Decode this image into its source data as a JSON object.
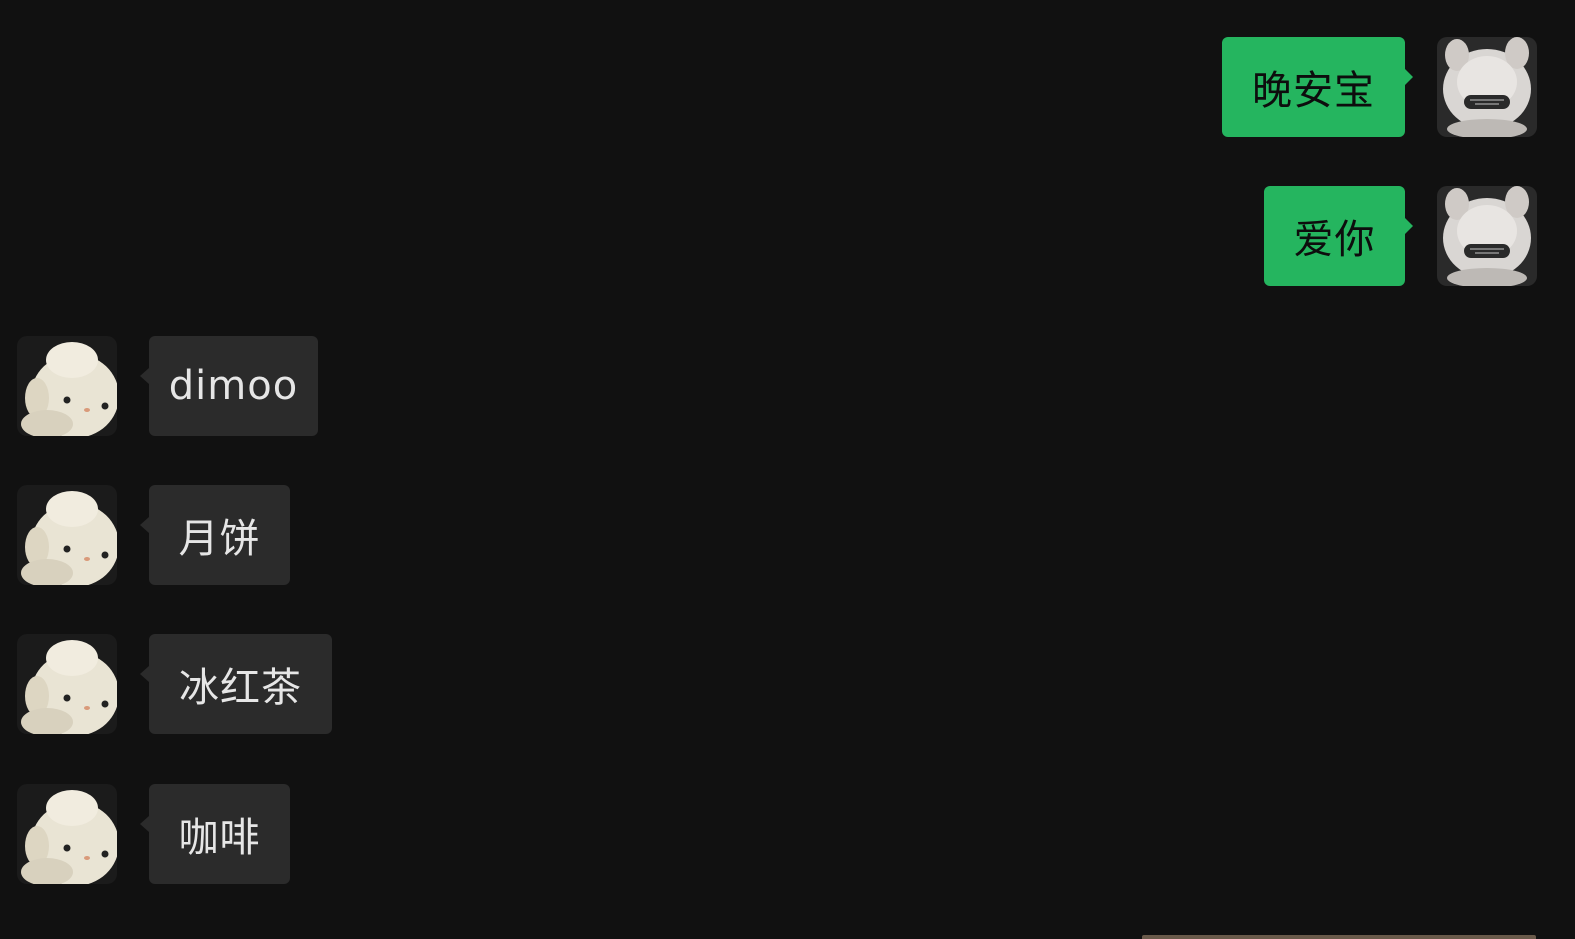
{
  "messages": [
    {
      "side": "out",
      "text": "晚安宝",
      "avatar": "fluffy-toy-avatar"
    },
    {
      "side": "out",
      "text": "爱你",
      "avatar": "fluffy-toy-avatar"
    },
    {
      "side": "in",
      "text": "dimoo",
      "avatar": "lamb-plush-avatar"
    },
    {
      "side": "in",
      "text": "月饼",
      "avatar": "lamb-plush-avatar"
    },
    {
      "side": "in",
      "text": "冰红茶",
      "avatar": "lamb-plush-avatar"
    },
    {
      "side": "in",
      "text": "咖啡",
      "avatar": "lamb-plush-avatar"
    }
  ],
  "colors": {
    "background": "#111111",
    "outgoing_bubble": "#25B55F",
    "incoming_bubble": "#2b2b2b"
  }
}
